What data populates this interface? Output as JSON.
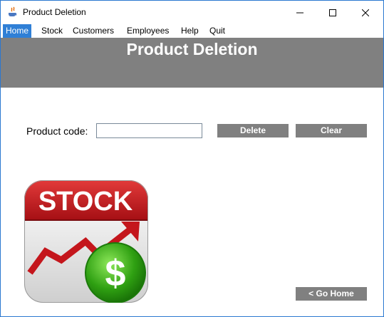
{
  "window": {
    "title": "Product Deletion"
  },
  "menu": {
    "items": [
      {
        "label": "Home",
        "active": true
      },
      {
        "label": "Stock",
        "active": false
      },
      {
        "label": "Customers",
        "active": false
      },
      {
        "label": "Employees",
        "active": false
      },
      {
        "label": "Help",
        "active": false
      },
      {
        "label": "Quit",
        "active": false
      }
    ]
  },
  "header": {
    "title": "Product Deletion"
  },
  "form": {
    "product_code_label": "Product code:",
    "product_code_value": "",
    "delete_label": "Delete",
    "clear_label": "Clear"
  },
  "logo": {
    "text": "STOCK",
    "symbol": "$"
  },
  "footer": {
    "go_home_label": "< Go Home"
  },
  "colors": {
    "banner": "#808080",
    "button": "#808080",
    "menu_active": "#2f7fd6",
    "logo_red": "#c4161c",
    "logo_green": "#2fa012"
  }
}
